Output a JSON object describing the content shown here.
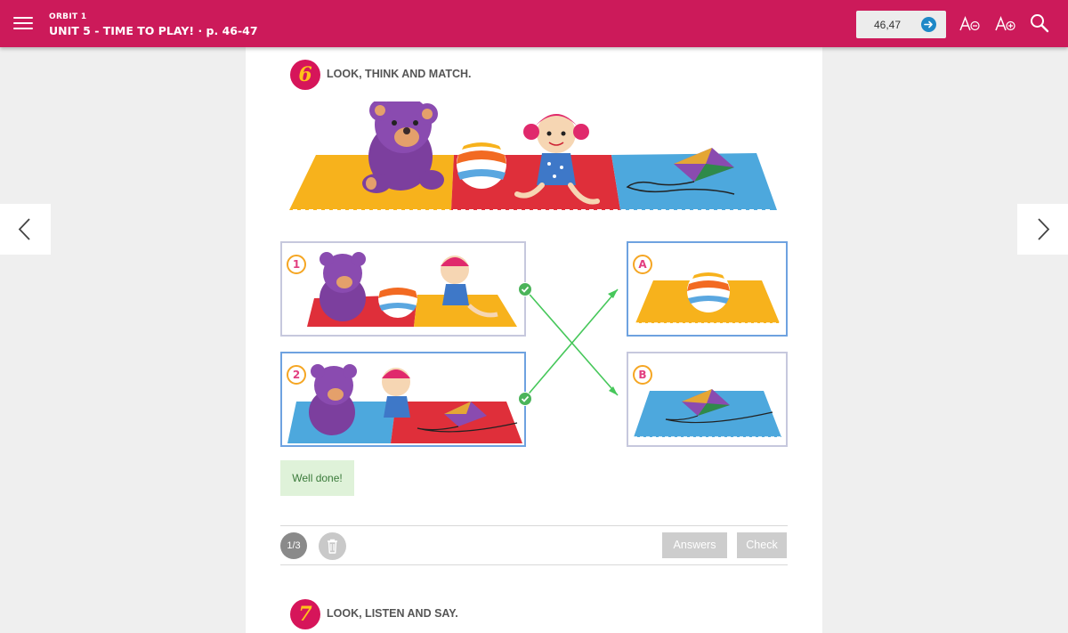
{
  "topbar": {
    "book": "ORBIT 1",
    "unit": "UNIT 5 - TIME TO PLAY! · p. 46-47",
    "page_value": "46,47",
    "icons": [
      "menu-icon",
      "arrow-right-icon",
      "font-decrease-icon",
      "font-increase-icon",
      "search-icon"
    ]
  },
  "exercise6": {
    "number": "6",
    "title": "LOOK, THINK AND MATCH.",
    "left_items": [
      {
        "label": "1",
        "matched": true
      },
      {
        "label": "2",
        "matched": true
      }
    ],
    "right_items": [
      {
        "label": "A"
      },
      {
        "label": "B"
      }
    ],
    "matches": [
      [
        "1",
        "B"
      ],
      [
        "2",
        "A"
      ]
    ],
    "feedback": "Well done!",
    "counter": "1/3",
    "answers_label": "Answers",
    "check_label": "Check"
  },
  "exercise7": {
    "number": "7",
    "title": "LOOK, LISTEN AND SAY."
  },
  "colors": {
    "brand": "#cc1a5a",
    "accent_blue": "#1e88c7",
    "success": "#4bb45a",
    "feedback_bg": "#dff2d9",
    "disabled_btn": "#cdcdcd"
  }
}
